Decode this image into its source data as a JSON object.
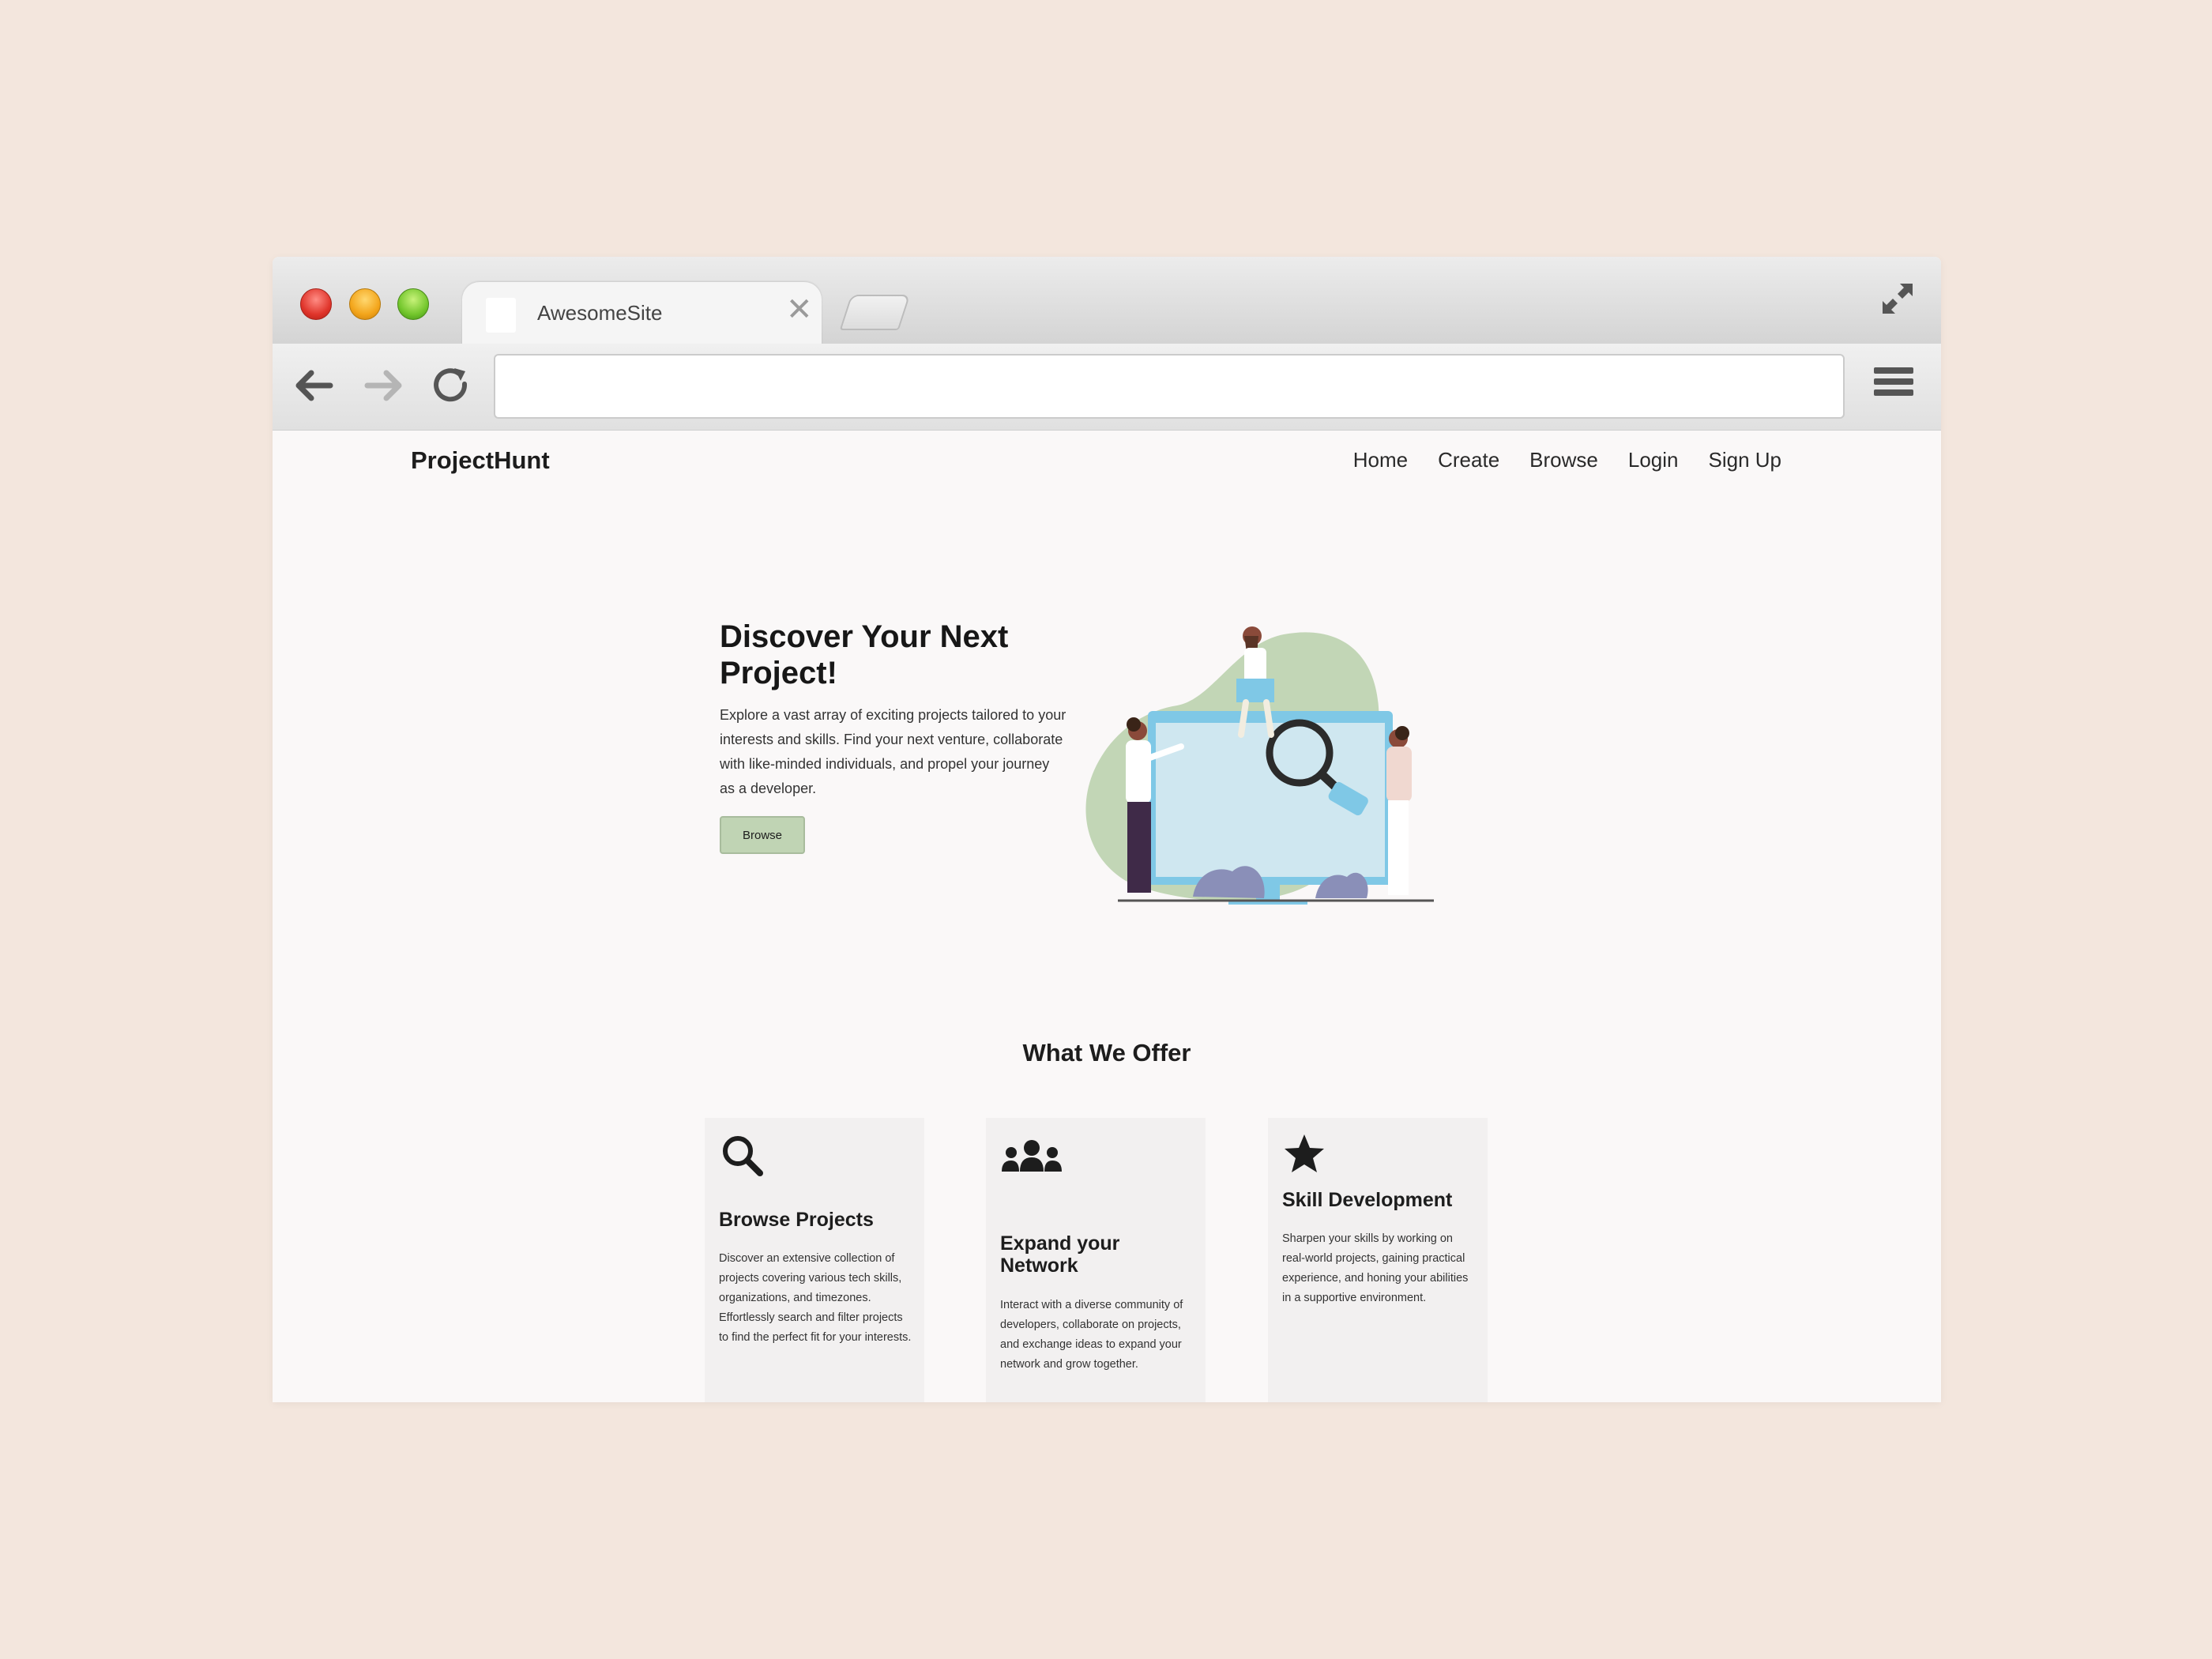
{
  "browser": {
    "tab_title": "AwesomeSite",
    "tab_close": "✕",
    "url": ""
  },
  "site": {
    "logo": "ProjectHunt",
    "nav": [
      "Home",
      "Create",
      "Browse",
      "Login",
      "Sign Up"
    ]
  },
  "hero": {
    "title": "Discover Your Next Project!",
    "text": "Explore a vast array of exciting projects tailored to your interests and skills. Find your next venture, collaborate with like-minded individuals, and propel your journey as a developer.",
    "button": "Browse",
    "illustration_colors": {
      "blob": "#c2d6b6",
      "monitor": "#7fc8e6",
      "screen": "#cfe7f0",
      "bushes": "#8a8fb8"
    }
  },
  "offer": {
    "title": "What We Offer",
    "cards": [
      {
        "icon": "search-icon",
        "title": "Browse Projects",
        "text": "Discover an extensive collection of projects covering various tech skills, organizations, and timezones. Effortlessly search and filter projects to find the perfect fit for your interests."
      },
      {
        "icon": "users-icon",
        "title": "Expand your Network",
        "text": "Interact with a diverse community of developers, collaborate on projects, and exchange ideas to expand your network and grow together."
      },
      {
        "icon": "star-icon",
        "title": "Skill Development",
        "text": "Sharpen your skills by working on real-world projects, gaining practical experience, and honing your abilities in a supportive environment."
      }
    ]
  },
  "colors": {
    "page_bg": "#f3e6dd",
    "site_bg": "#faf8f8",
    "card_bg": "#f2f0f0",
    "accent_button": "#c0d4b4"
  }
}
